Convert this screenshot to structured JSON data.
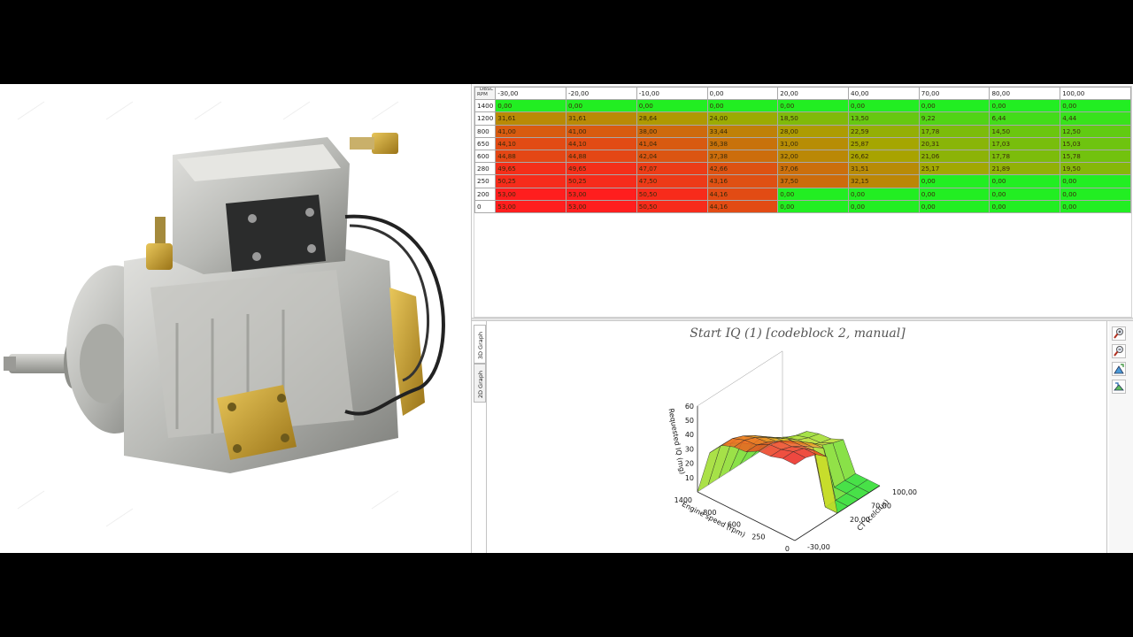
{
  "map_table": {
    "corner_label_top": "DBSC",
    "corner_label_bottom": "RPM",
    "col_headers": [
      "-30,00",
      "-20,00",
      "-10,00",
      "0,00",
      "20,00",
      "40,00",
      "70,00",
      "80,00",
      "100,00"
    ],
    "rows": [
      {
        "rpm": "1400",
        "values": [
          "0,00",
          "0,00",
          "0,00",
          "0,00",
          "0,00",
          "0,00",
          "0,00",
          "0,00",
          "0,00"
        ]
      },
      {
        "rpm": "1200",
        "values": [
          "31,61",
          "31,61",
          "28,64",
          "24,00",
          "18,50",
          "13,50",
          "9,22",
          "6,44",
          "4,44"
        ]
      },
      {
        "rpm": "800",
        "values": [
          "41,00",
          "41,00",
          "38,00",
          "33,44",
          "28,00",
          "22,59",
          "17,78",
          "14,50",
          "12,50"
        ]
      },
      {
        "rpm": "650",
        "values": [
          "44,10",
          "44,10",
          "41,04",
          "36,38",
          "31,00",
          "25,87",
          "20,31",
          "17,03",
          "15,03"
        ]
      },
      {
        "rpm": "600",
        "values": [
          "44,88",
          "44,88",
          "42,04",
          "37,38",
          "32,00",
          "26,62",
          "21,06",
          "17,78",
          "15,78"
        ]
      },
      {
        "rpm": "280",
        "values": [
          "49,65",
          "49,65",
          "47,07",
          "42,66",
          "37,06",
          "31,51",
          "25,17",
          "21,89",
          "19,50"
        ]
      },
      {
        "rpm": "250",
        "values": [
          "50,25",
          "50,25",
          "47,50",
          "43,16",
          "37,50",
          "32,15",
          "0,00",
          "0,00",
          "0,00"
        ]
      },
      {
        "rpm": "200",
        "values": [
          "53,00",
          "53,00",
          "50,50",
          "44,16",
          "0,00",
          "0,00",
          "0,00",
          "0,00",
          "0,00"
        ]
      },
      {
        "rpm": "0",
        "values": [
          "53,00",
          "53,00",
          "50,50",
          "44,16",
          "0,00",
          "0,00",
          "0,00",
          "0,00",
          "0,00"
        ]
      }
    ],
    "max_value": 53,
    "color_low": "#22ee22",
    "color_mid": "#a8a400",
    "color_high": "#ff1e1e"
  },
  "graph": {
    "title": "Start IQ (1) [codeblock 2, manual]",
    "tabs": [
      "3D Graph",
      "2D Graph"
    ],
    "active_tab": "3D Graph",
    "z_axis_label": "Requested IQ (mg)",
    "x_axis_label": "Engine speed (rpm)",
    "y_axis_label": "CT (celcius)",
    "z_ticks": [
      "60",
      "50",
      "40",
      "30",
      "20",
      "10"
    ],
    "x_ticks": [
      "1400",
      "800",
      "600",
      "250",
      "0"
    ],
    "y_ticks": [
      "100,00",
      "70,00",
      "20,00",
      "-30,00"
    ],
    "toolbar_icons": [
      "zoom-in-icon",
      "zoom-out-icon",
      "rotate-up-icon",
      "rotate-down-icon"
    ]
  }
}
